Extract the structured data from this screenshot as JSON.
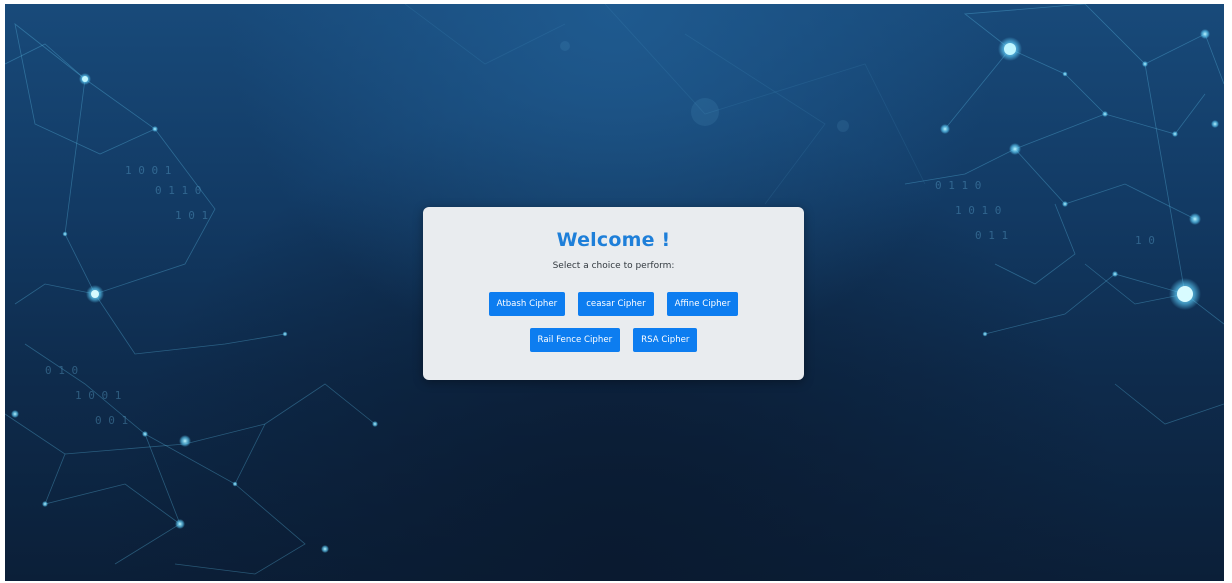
{
  "welcome": {
    "title": "Welcome !",
    "subtitle": "Select a choice to perform:"
  },
  "choices": {
    "atbash": "Atbash Cipher",
    "ceasar": "ceasar Cipher",
    "affine": "Affine Cipher",
    "rail_fence": "Rail Fence Cipher",
    "rsa": "RSA Cipher"
  },
  "colors": {
    "background_top": "#184a7a",
    "background_bottom": "#0b1f38",
    "card_background": "#e9ecef",
    "title_blue": "#1e7fd9",
    "button_blue": "#0d7df0",
    "button_text": "#ffffff",
    "network_glow": "#6fe0ff"
  },
  "background_icon": "digital-network-background"
}
